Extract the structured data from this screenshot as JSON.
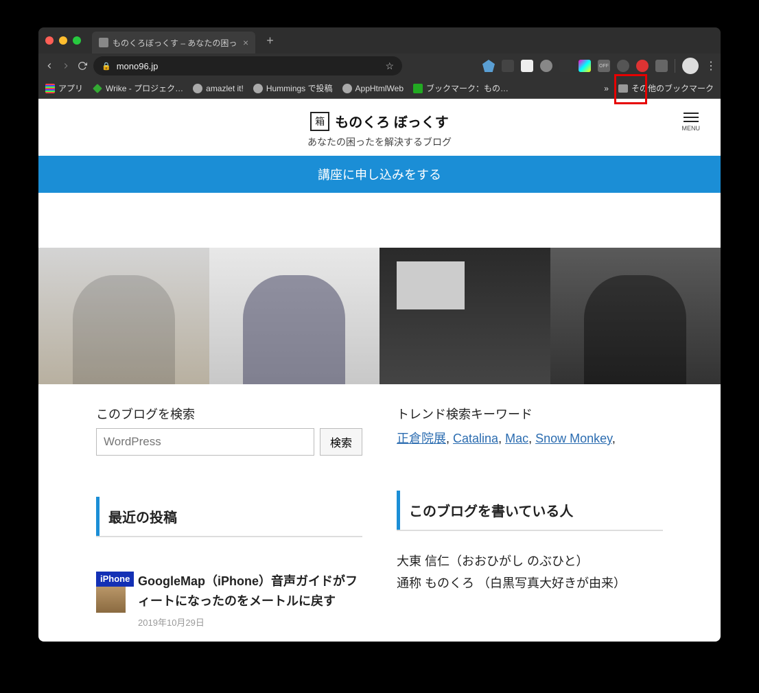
{
  "browser": {
    "tab_title": "ものくろぼっくす – あなたの困っ…",
    "url": "mono96.jp",
    "bookmarks": [
      {
        "label": "アプリ",
        "icon": "grid"
      },
      {
        "label": "Wrike - プロジェク…",
        "icon": "green"
      },
      {
        "label": "amazlet it!",
        "icon": "globe"
      },
      {
        "label": "Hummings で投稿",
        "icon": "globe"
      },
      {
        "label": "AppHtmlWeb",
        "icon": "globe"
      },
      {
        "label": "ブックマーク：もの…",
        "icon": "greensq"
      }
    ],
    "other_bookmarks": "その他のブックマーク"
  },
  "site": {
    "title": "ものくろ ぼっくす",
    "subtitle": "あなたの困ったを解決するブログ",
    "menu_label": "MENU",
    "banner": "講座に申し込みをする"
  },
  "left": {
    "search_label": "このブログを検索",
    "search_placeholder": "WordPress",
    "search_button": "検索",
    "recent_heading": "最近の投稿",
    "post": {
      "badge": "iPhone",
      "title": "GoogleMap（iPhone）音声ガイドがフィートになったのをメートルに戻す",
      "date": "2019年10月29日"
    }
  },
  "right": {
    "trend_label": "トレンド検索キーワード",
    "keywords": [
      "正倉院展",
      "Catalina",
      "Mac",
      "Snow Monkey"
    ],
    "author_heading": "このブログを書いている人",
    "author_lines": [
      "大東 信仁（おおひがし のぶひと）",
      "通称 ものくろ （白黒写真大好きが由来）"
    ]
  }
}
